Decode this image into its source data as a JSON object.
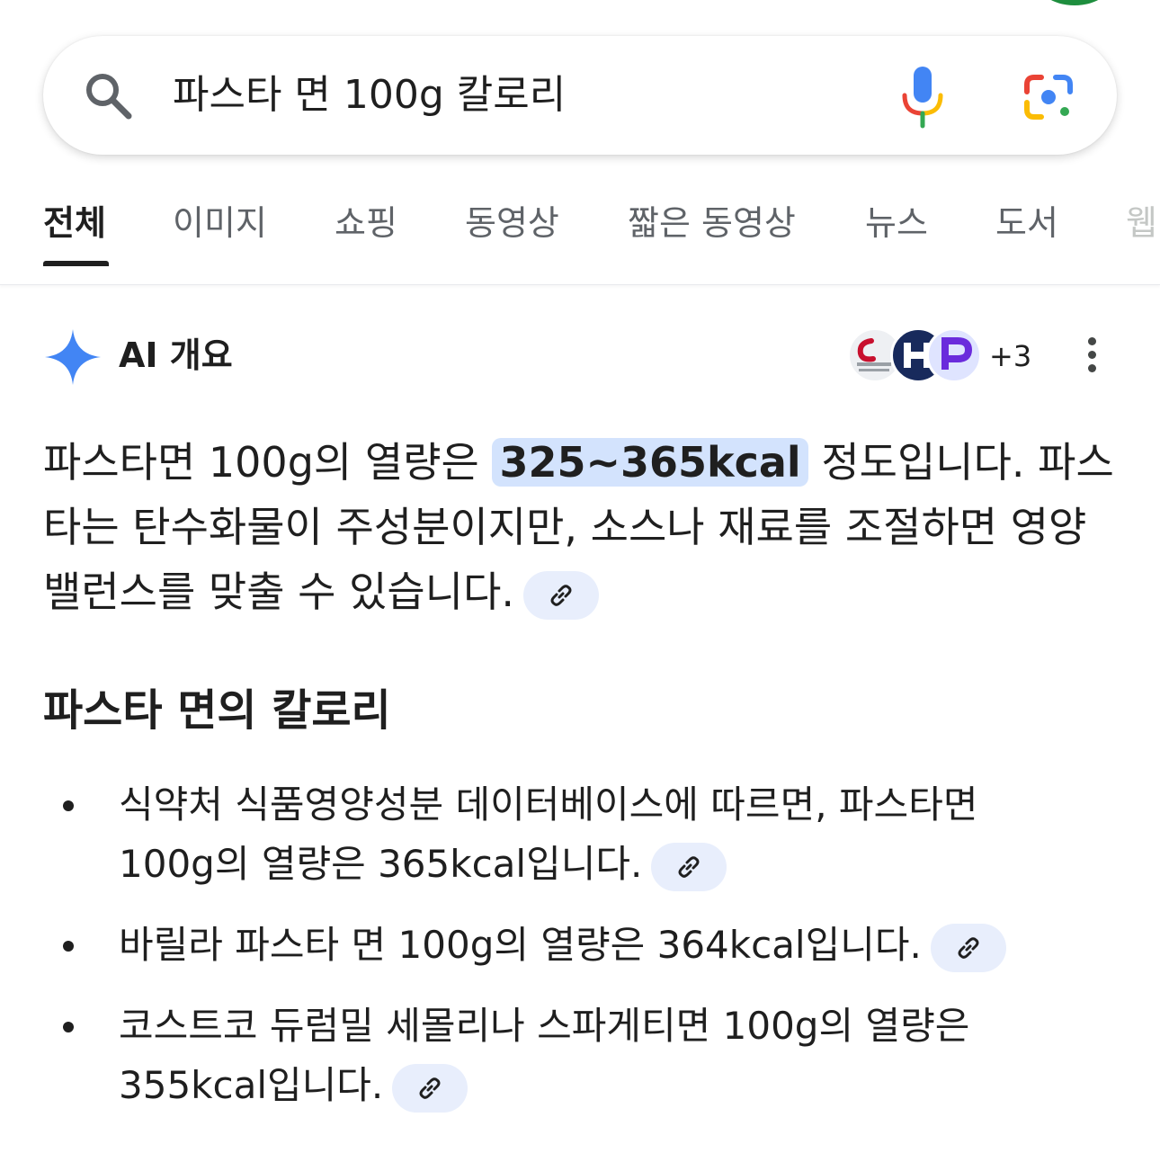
{
  "search": {
    "query": "파스타 면 100g 칼로리"
  },
  "tabs": [
    {
      "label": "전체",
      "active": true
    },
    {
      "label": "이미지"
    },
    {
      "label": "쇼핑"
    },
    {
      "label": "동영상"
    },
    {
      "label": "짧은 동영상"
    },
    {
      "label": "뉴스"
    },
    {
      "label": "도서"
    },
    {
      "label": "웹"
    }
  ],
  "ai_overview": {
    "title": "AI 개요",
    "sources_more": "+3",
    "source_logos": [
      {
        "name": "헬스조선",
        "logo_text": "Chosunhealth 헬스조선",
        "color": "#c8102e"
      },
      {
        "name": "H",
        "logo_text": "H",
        "color": "#182a5c"
      },
      {
        "name": "P",
        "logo_text": "P",
        "color": "#6a2bdc"
      }
    ],
    "summary_before": "파스타면 100g의 열량은 ",
    "summary_highlight": "325~365kcal",
    "summary_after": " 정도입니다. 파스타는 탄수화물이 주성분이지만, 소스나 재료를 조절하면 영양 밸런스를 맞출 수 있습니다.",
    "section_heading": "파스타 면의 칼로리",
    "bullets": [
      "식약처 식품영양성분 데이터베이스에 따르면, 파스타면 100g의 열량은 365kcal입니다.",
      "바릴라 파스타 면 100g의 열량은 364kcal입니다.",
      "코스트코 듀럼밀 세몰리나 스파게티면 100g의 열량은 355kcal입니다."
    ]
  },
  "colors": {
    "accent_blue": "#4285f4",
    "highlight_bg": "#d3e3fd",
    "chip_bg": "#e8eefc",
    "google_red": "#ea4335",
    "google_yellow": "#fbbc04",
    "google_green": "#34a853"
  }
}
